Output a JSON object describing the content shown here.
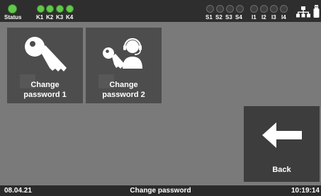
{
  "status_bar": {
    "status_label": "Status",
    "k_leds": [
      {
        "label": "K1",
        "state": "on"
      },
      {
        "label": "K2",
        "state": "on"
      },
      {
        "label": "K3",
        "state": "on"
      },
      {
        "label": "K4",
        "state": "on"
      }
    ],
    "s_leds": [
      {
        "label": "S1",
        "state": "off"
      },
      {
        "label": "S2",
        "state": "off"
      },
      {
        "label": "S3",
        "state": "off"
      },
      {
        "label": "S4",
        "state": "off"
      }
    ],
    "i_leds": [
      {
        "label": "I1",
        "state": "off"
      },
      {
        "label": "I2",
        "state": "off"
      },
      {
        "label": "I3",
        "state": "off"
      },
      {
        "label": "I4",
        "state": "off"
      }
    ],
    "icons": [
      "network-icon",
      "usb-icon"
    ],
    "colors": {
      "led_on": "#62c84a",
      "led_off": "#3e3e3e"
    }
  },
  "tiles": {
    "change_password_1": {
      "line1": "Change",
      "line2": "password 1",
      "icon": "key-icon"
    },
    "change_password_2": {
      "line1": "Change",
      "line2": "password 2",
      "icon": "key-user-headset-icon"
    },
    "back": {
      "label": "Back",
      "icon": "arrow-left-icon"
    }
  },
  "bottom_bar": {
    "date": "08.04.21",
    "title": "Change password",
    "time": "10:19:14"
  }
}
